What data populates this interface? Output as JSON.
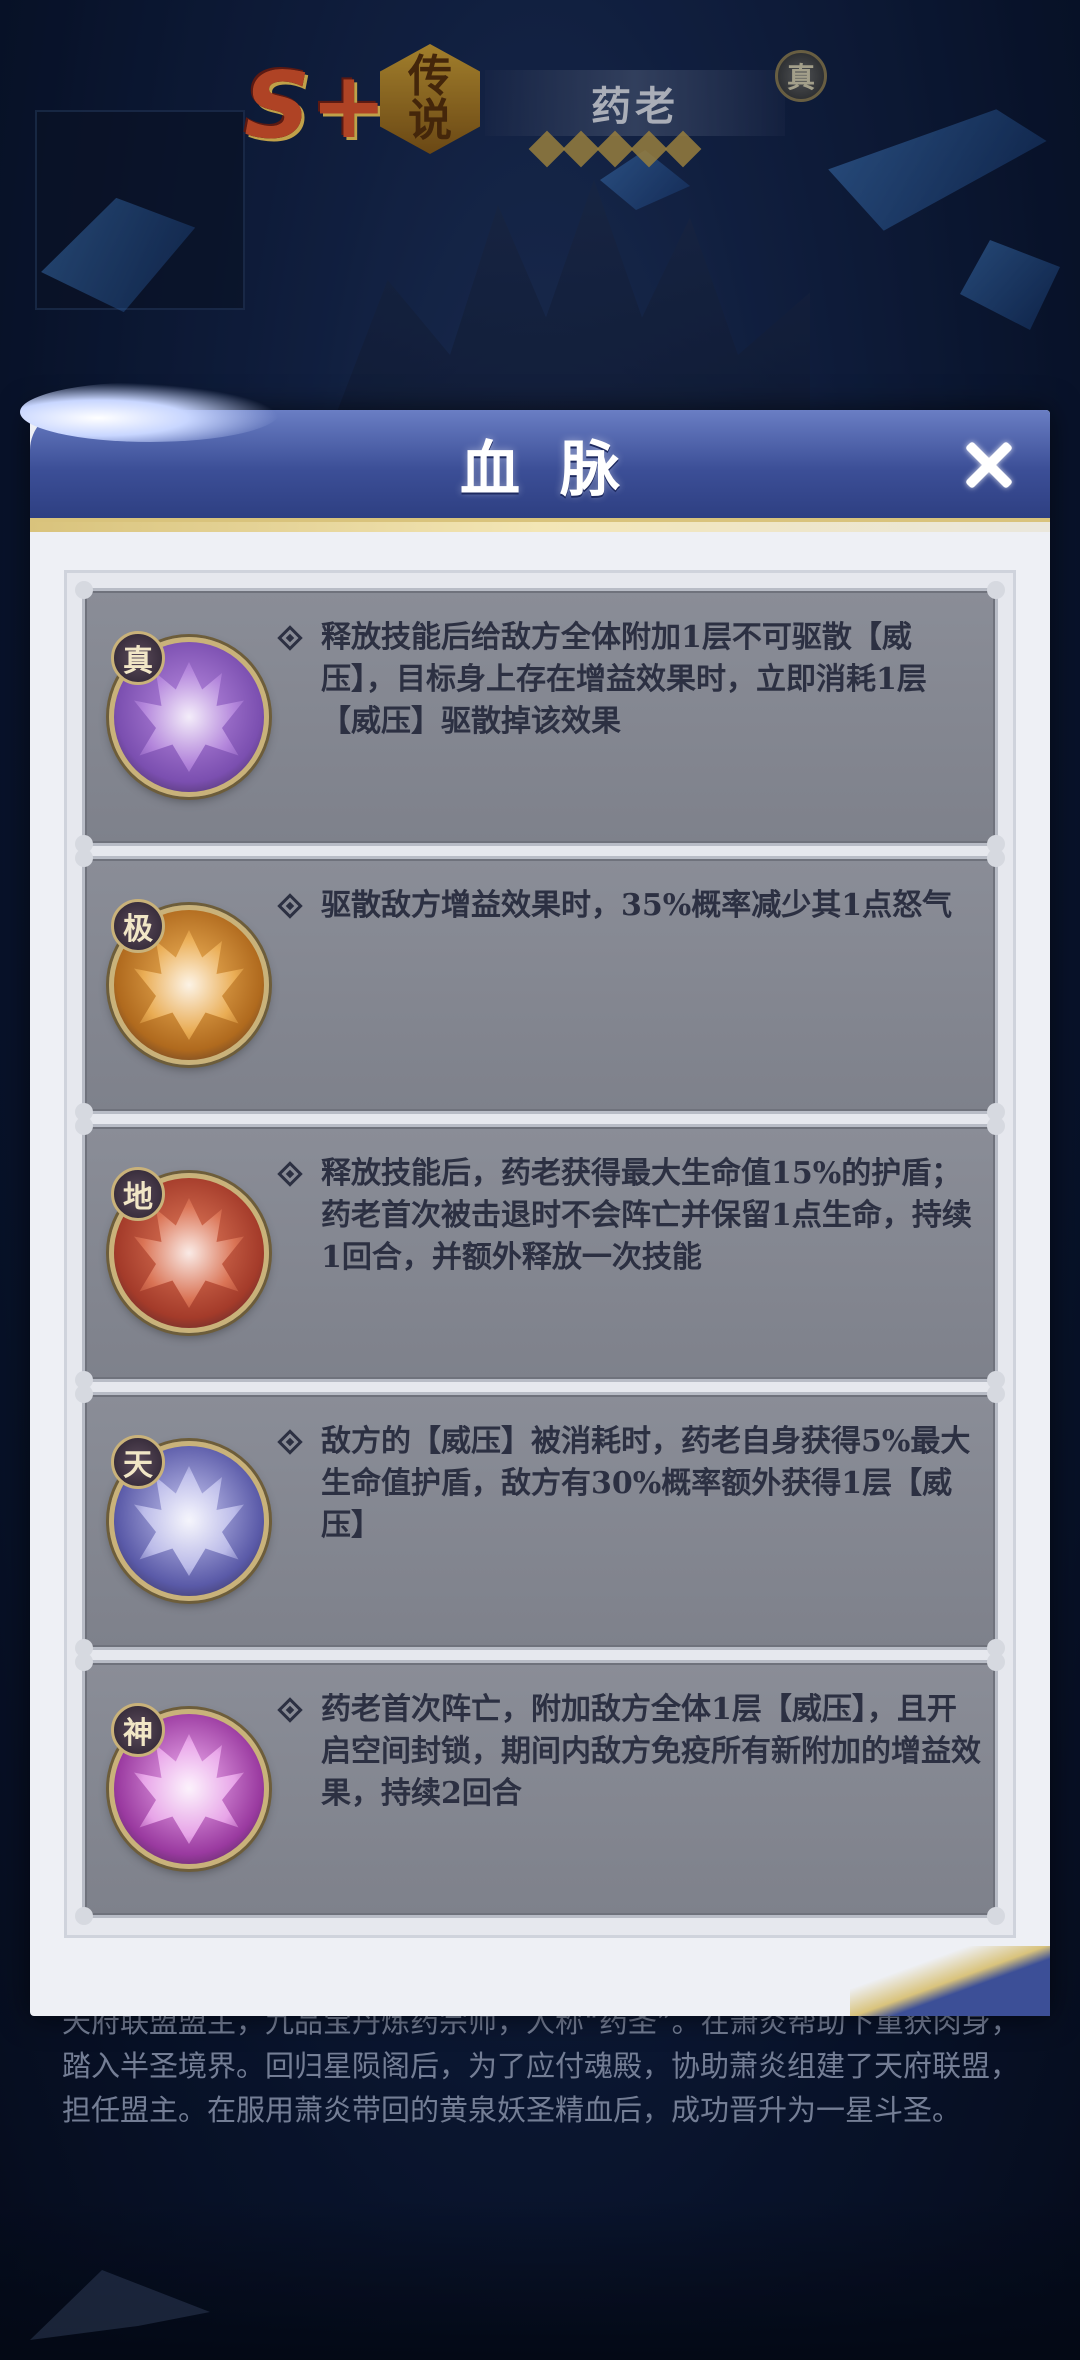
{
  "hero": {
    "rank": "S+",
    "quality": "传说",
    "name": "药老",
    "true_badge": "真",
    "stars": 5
  },
  "bio": {
    "text": "天府联盟盟主，九品宝丹炼药宗师，人称“药圣”。在萧炎帮助下重获肉身，踏入半圣境界。回归星陨阁后，为了应付魂殿，协助萧炎组建了天府联盟，担任盟主。在服用萧炎带回的黄泉妖圣精血后，成功晋升为一星斗圣。"
  },
  "modal": {
    "title": "血脉",
    "close_icon": "close-icon",
    "colors": {
      "header": "#3c4f97",
      "gold": "#d9c37c",
      "card": "#868993"
    },
    "tiers": [
      {
        "tier": "真",
        "emblem_color": "#7b4fb0",
        "emblem_glow": "#b98be0",
        "desc": "释放技能后给敌方全体附加1层不可驱散【威压】，目标身上存在增益效果时，立即消耗1层【威压】驱散掉该效果"
      },
      {
        "tier": "极",
        "emblem_color": "#b06a1e",
        "emblem_glow": "#f0b45a",
        "desc": "驱散敌方增益效果时，35%概率减少其1点怒气"
      },
      {
        "tier": "地",
        "emblem_color": "#a43b2a",
        "emblem_glow": "#e07a5a",
        "desc": "释放技能后，药老获得最大生命值15%的护盾；药老首次被击退时不会阵亡并保留1点生命，持续1回合，并额外释放一次技能"
      },
      {
        "tier": "天",
        "emblem_color": "#5a5aa8",
        "emblem_glow": "#c6c6f0",
        "desc": "敌方的【威压】被消耗时，药老自身获得5%最大生命值护盾，敌方有30%概率额外获得1层【威压】"
      },
      {
        "tier": "神",
        "emblem_color": "#9a3aa0",
        "emblem_glow": "#f0b0f0",
        "desc": "药老首次阵亡，附加敌方全体1层【威压】，且开启空间封锁，期间内敌方免疫所有新附加的增益效果，持续2回合"
      }
    ]
  }
}
